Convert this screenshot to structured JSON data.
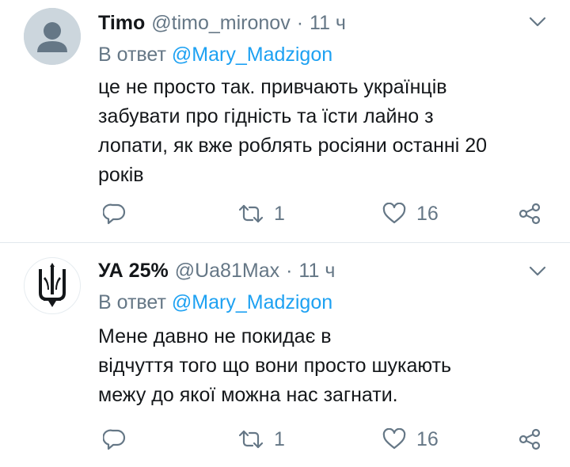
{
  "colors": {
    "accent": "#1da1f2",
    "secondary_text": "#657786",
    "primary_text": "#14171a",
    "divider": "#e1e8ed"
  },
  "tweets": [
    {
      "name": "Timo",
      "handle": "@timo_mironov",
      "separator": "·",
      "time": "11 ч",
      "reply_prefix": "В ответ",
      "reply_handle": "@Mary_Madzigon",
      "text_lines": [
        "це не просто так. привчають українців",
        "забувати про гідність та їсти лайно з",
        "лопати, як вже роблять росіяни останні 20",
        "років"
      ],
      "retweets": "1",
      "likes": "16",
      "icons": {
        "avatar": "default-avatar-icon",
        "menu": "chevron-down-icon",
        "reply": "reply-icon",
        "retweet": "retweet-icon",
        "like": "heart-icon",
        "share": "share-icon"
      }
    },
    {
      "name": "УА 25%",
      "handle": "@Ua81Max",
      "separator": "·",
      "time": "11 ч",
      "reply_prefix": "В ответ",
      "reply_handle": "@Mary_Madzigon",
      "text_lines": [
        "Мене давно не покидає в",
        "відчуття того що вони просто шукають",
        "межу до якої можна нас загнати."
      ],
      "retweets": "1",
      "likes": "16",
      "icons": {
        "avatar": "trident-icon",
        "menu": "chevron-down-icon",
        "reply": "reply-icon",
        "retweet": "retweet-icon",
        "like": "heart-icon",
        "share": "share-icon"
      }
    }
  ]
}
